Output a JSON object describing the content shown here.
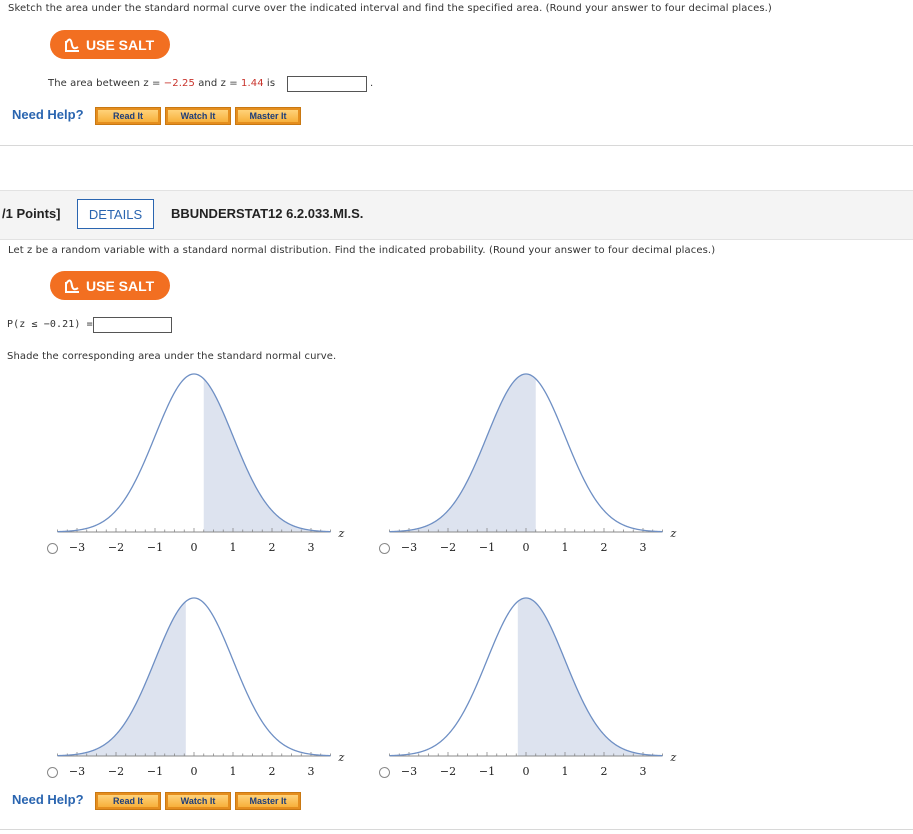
{
  "q1": {
    "instructions": "Sketch the area under the standard normal curve over the indicated interval and find the specified area. (Round your answer to four decimal places.)",
    "salt_label": "USE SALT",
    "area_prefix": "The area between z = ",
    "z1": "−2.25",
    "area_mid": " and z = ",
    "z2": "1.44",
    "area_suffix": " is",
    "period": "."
  },
  "help1": {
    "label": "Need Help?",
    "read": "Read It",
    "watch": "Watch It",
    "master": "Master It"
  },
  "q2": {
    "points": "/1 Points]",
    "details": "DETAILS",
    "id": "BBUNDERSTAT12 6.2.033.MI.S.",
    "instructions": "Let z be a random variable with a standard normal distribution. Find the indicated probability. (Round your answer to four decimal places.)",
    "salt_label": "USE SALT",
    "prob_label": "P(z ≤ −0.21) =",
    "shade_text": "Shade the corresponding area under the standard normal curve.",
    "z_label": "z",
    "tick_labels": [
      "−3",
      "−2",
      "−1",
      "0",
      "1",
      "2",
      "3"
    ],
    "options": [
      {
        "name": "option-a",
        "shade_from": 0.25,
        "shade_to": 3.5
      },
      {
        "name": "option-b",
        "shade_from": -3.5,
        "shade_to": 0.25
      },
      {
        "name": "option-c",
        "shade_from": -3.5,
        "shade_to": -0.21
      },
      {
        "name": "option-d",
        "shade_from": -0.21,
        "shade_to": 3.5
      }
    ]
  },
  "help2": {
    "label": "Need Help?",
    "read": "Read It",
    "watch": "Watch It",
    "master": "Master It"
  },
  "colors": {
    "salt_orange": "#f26f21",
    "link_blue": "#2a65b0",
    "curve": "#6e8fc4",
    "shade": "#dde3ef"
  }
}
